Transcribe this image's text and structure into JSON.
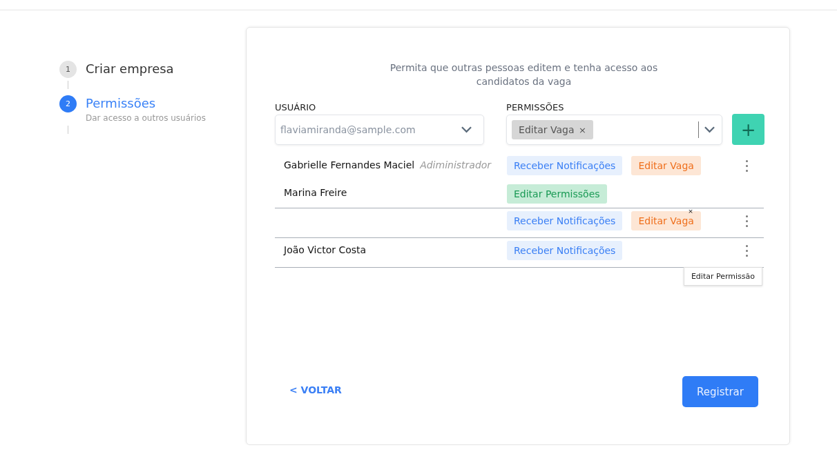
{
  "steps": [
    {
      "number": "1",
      "title": "Criar empresa",
      "selected": false
    },
    {
      "number": "2",
      "title": "Permissões",
      "subtitle": "Dar acesso a outros usuários",
      "selected": true
    }
  ],
  "intro": "Permita que outras pessoas editem e tenha acesso aos candidatos da vaga",
  "user_field": {
    "label": "USUÁRIO",
    "placeholder": "flaviamiranda@sample.com"
  },
  "permissions_field": {
    "label": "PERMISSÕES",
    "chips": [
      {
        "label": "Editar Vaga",
        "remove": "×"
      }
    ]
  },
  "add_button": "+",
  "rows": [
    {
      "users": [
        {
          "name": "Gabrielle Fernandes Maciel",
          "role": "Adiministrador"
        },
        {
          "name": "Marina Freire"
        }
      ],
      "tags": [
        {
          "kind": "notify",
          "label": "Receber Notificações"
        },
        {
          "kind": "edit",
          "label": "Editar Vaga"
        },
        {
          "kind": "perm",
          "label": "Editar Permissões"
        }
      ]
    },
    {
      "tags": [
        {
          "kind": "notify",
          "label": "Receber Notificações"
        },
        {
          "kind": "edit",
          "label": "Editar Vaga",
          "remove": "×"
        }
      ]
    },
    {
      "users": [
        {
          "name": "João Victor Costa"
        }
      ],
      "tags": [
        {
          "kind": "notify",
          "label": "Receber Notificações"
        }
      ],
      "tooltip": "Editar Permissão"
    }
  ],
  "back_link": "< VOLTAR",
  "submit_button": "Registrar"
}
